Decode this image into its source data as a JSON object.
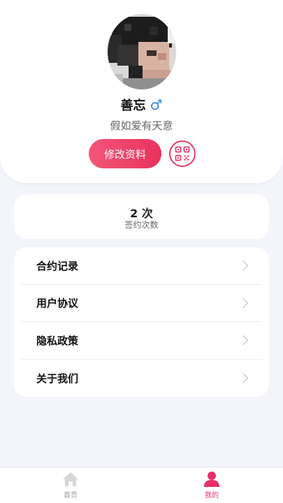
{
  "profile": {
    "name": "善忘",
    "gender_symbol": "♂",
    "signature": "假如爱有天意",
    "edit_button_label": "修改资料",
    "avatar": "avatar-photo-pixelated",
    "qr_icon": "qr-code-icon"
  },
  "stats": {
    "value": "2 次",
    "label": "签约次数"
  },
  "menu": {
    "items": [
      {
        "label": "合约记录",
        "icon": "chevron-right-icon"
      },
      {
        "label": "用户协议",
        "icon": "chevron-right-icon"
      },
      {
        "label": "隐私政策",
        "icon": "chevron-right-icon"
      },
      {
        "label": "关于我们",
        "icon": "chevron-right-icon"
      }
    ]
  },
  "tabbar": {
    "tabs": [
      {
        "label": "首页",
        "icon": "home-icon",
        "active": false
      },
      {
        "label": "我的",
        "icon": "person-icon",
        "active": true
      }
    ]
  },
  "colors": {
    "accent": "#e83d6a",
    "gender": "#2f8ce8",
    "background": "#f3f5fb"
  }
}
